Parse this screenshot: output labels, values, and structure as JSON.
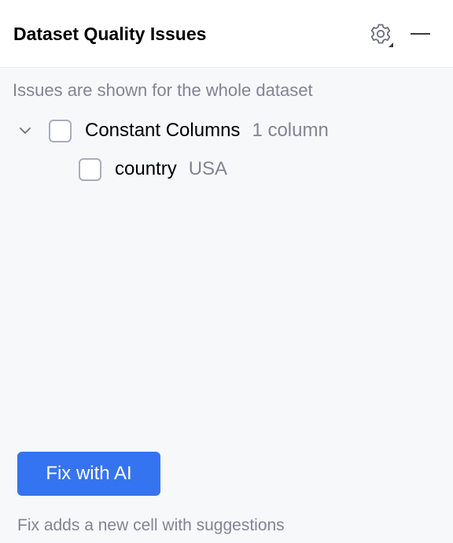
{
  "panel": {
    "title": "Dataset Quality Issues"
  },
  "info_text": "Issues are shown for the whole dataset",
  "tree": {
    "group": {
      "label": "Constant Columns",
      "hint": "1 column",
      "expanded": true,
      "checked": false
    },
    "items": [
      {
        "label": "country",
        "hint": "USA",
        "checked": false
      }
    ]
  },
  "action": {
    "button_label": "Fix with AI",
    "note": "Fix adds a new cell with suggestions"
  },
  "colors": {
    "accent": "#3574f0",
    "secondary_text": "#818594",
    "panel_background": "#f7f8fa",
    "header_background": "#ffffff"
  }
}
